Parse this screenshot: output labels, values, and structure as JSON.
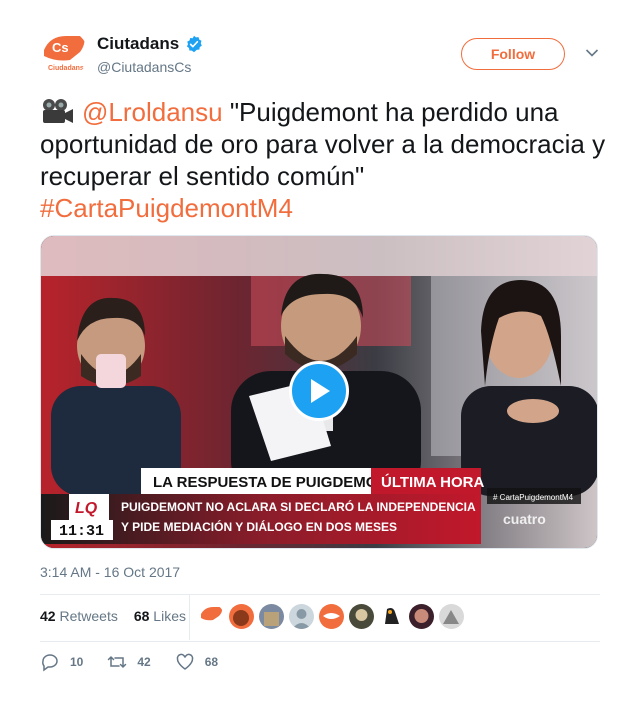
{
  "account": {
    "name": "Ciutadans",
    "handle": "@CiutadansCs",
    "logo_text": "Cs",
    "logo_subtext": "Ciudadans"
  },
  "follow_label": "Follow",
  "tweet": {
    "mention": "@Lroldansu",
    "quote": " \"Puigdemont ha perdido una oportunidad de oro para volver a la democracia y recuperar el sentido común\"",
    "hashtag": "#CartaPuigdemontM4"
  },
  "video": {
    "overlay_title": "LA RESPUESTA DE PUIGDEMONT",
    "breaking": "ÚLTIMA HORA",
    "hashtag_overlay": "# CartaPuigdemontM4",
    "ticker_line1": "PUIGDEMONT NO ACLARA SI DECLARÓ LA INDEPENDENCIA",
    "ticker_line2": "Y PIDE MEDIACIÓN Y DIÁLOGO EN DOS MESES",
    "time": "11:31",
    "channel": "cuatro"
  },
  "timestamp": "3:14 AM - 16 Oct 2017",
  "stats": {
    "retweets_count": "42",
    "retweets_label": "Retweets",
    "likes_count": "68",
    "likes_label": "Likes"
  },
  "actions": {
    "replies": "10",
    "retweets": "42",
    "likes": "68"
  },
  "colors": {
    "brand": "#f26d3d",
    "play": "#1da1f2",
    "verified": "#1da1f2"
  }
}
